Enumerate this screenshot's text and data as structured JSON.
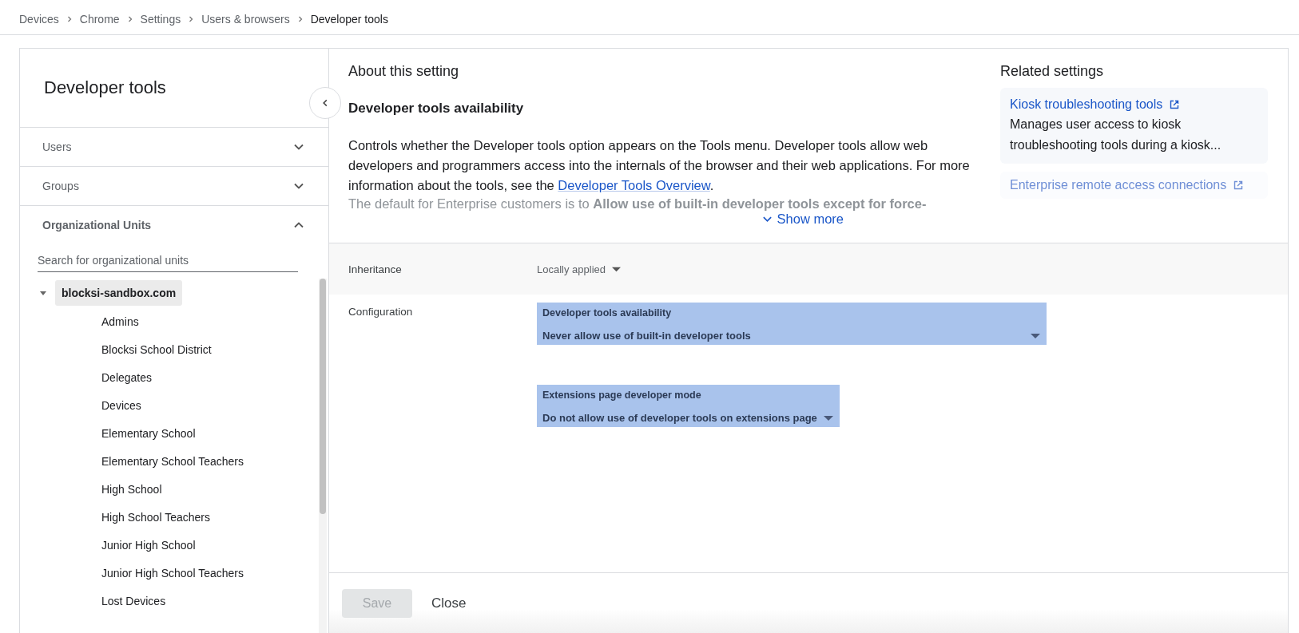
{
  "breadcrumb": [
    {
      "label": "Devices",
      "current": false
    },
    {
      "label": "Chrome",
      "current": false
    },
    {
      "label": "Settings",
      "current": false
    },
    {
      "label": "Users & browsers",
      "current": false
    },
    {
      "label": "Developer tools",
      "current": true
    }
  ],
  "sidebar": {
    "title": "Developer tools",
    "sections": [
      {
        "label": "Users",
        "expanded": false
      },
      {
        "label": "Groups",
        "expanded": false
      },
      {
        "label": "Organizational Units",
        "expanded": true
      }
    ],
    "search": {
      "placeholder": "Search for organizational units"
    },
    "tree": [
      {
        "label": "blocksi-sandbox.com",
        "selected": true,
        "expanded": true,
        "children": [
          {
            "label": "Admins",
            "selected": false
          },
          {
            "label": "Blocksi School District",
            "selected": false
          },
          {
            "label": "Delegates",
            "selected": false
          },
          {
            "label": "Devices",
            "selected": false
          },
          {
            "label": "Elementary School",
            "selected": false
          },
          {
            "label": "Elementary School Teachers",
            "selected": false
          },
          {
            "label": "High School",
            "selected": false
          },
          {
            "label": "High School Teachers",
            "selected": false
          },
          {
            "label": "Junior High School",
            "selected": false
          },
          {
            "label": "Junior High School Teachers",
            "selected": false
          },
          {
            "label": "Lost Devices",
            "selected": false
          }
        ]
      }
    ]
  },
  "about": {
    "title": "About this setting",
    "subtitle": "Developer tools availability",
    "text_before_link": "Controls whether the Developer tools option appears on the Tools menu. Developer tools allow web developers and programmers access into the internals of the browser and their web applications. For more information about the tools, see the",
    "link": "Developer Tools Overview",
    "text_after_link": ".",
    "faded_text": "The default for Enterprise customers is to **Allow use of built-in developer tools except for force-**",
    "show_more": "Show more"
  },
  "related": {
    "title": "Related settings",
    "items": [
      {
        "title": "Kiosk troubleshooting tools",
        "description": "Manages user access to kiosk troubleshooting tools during a kiosk...",
        "faded": false
      },
      {
        "title": "Enterprise remote access connections",
        "faded": true
      }
    ]
  },
  "inheritance": {
    "label": "Inheritance",
    "value": "Locally applied"
  },
  "configuration": {
    "label": "Configuration",
    "fields": [
      {
        "label": "Developer tools availability",
        "value": "Never allow use of built-in developer tools",
        "wide": true
      },
      {
        "label": "Extensions page developer mode",
        "value": "Do not allow use of developer tools on extensions page",
        "wide": false
      }
    ]
  },
  "footer": {
    "save": {
      "label": "Save",
      "disabled": true
    },
    "close": "Close"
  }
}
